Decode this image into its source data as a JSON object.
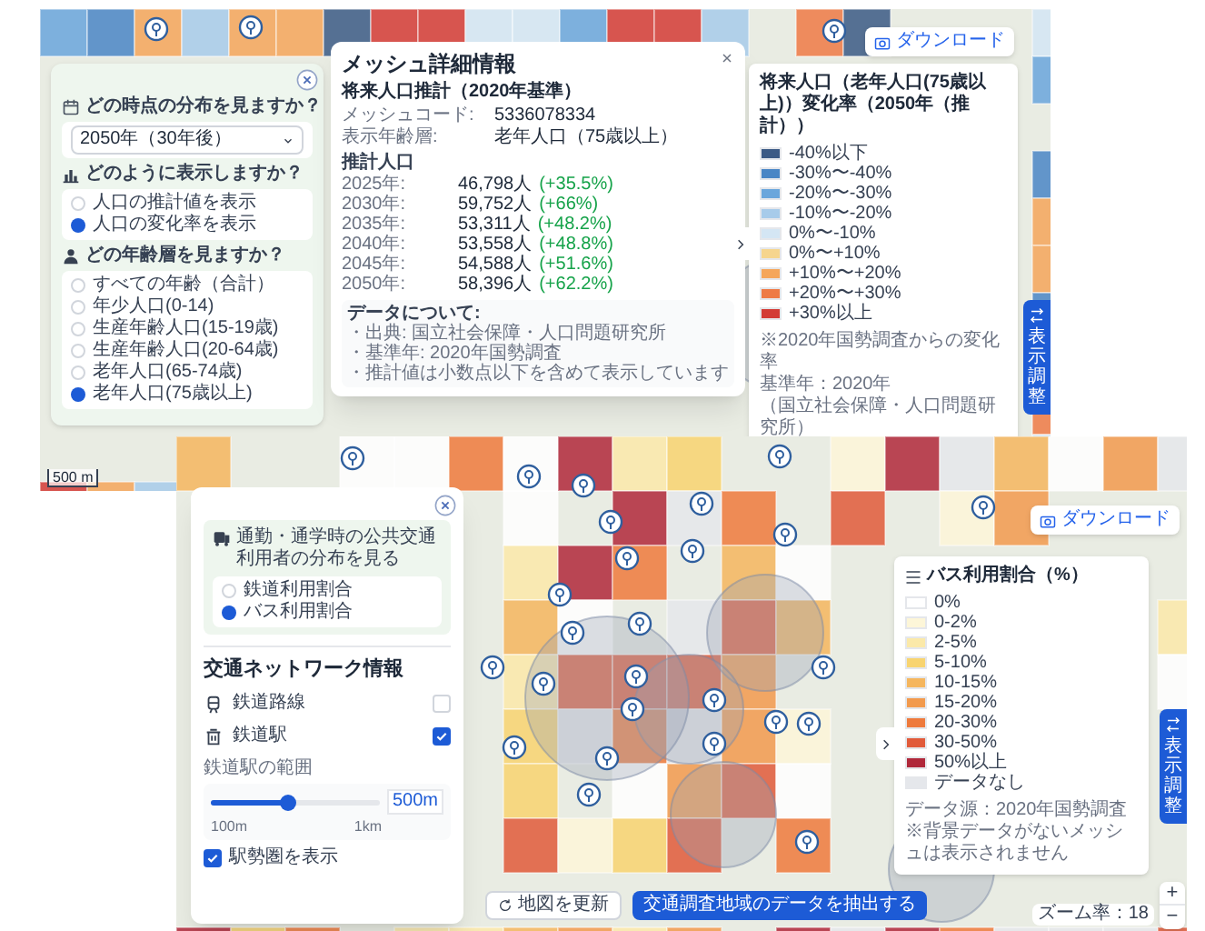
{
  "population_map": {
    "download": "ダウンロード",
    "scale": "500 m",
    "side_button": "表示調整",
    "panel": {
      "sections": [
        {
          "kind": "select",
          "title": "どの時点の分布を見ますか？",
          "value": "2050年（30年後）"
        },
        {
          "kind": "radio",
          "title": "どのように表示しますか？",
          "options": [
            {
              "label": "人口の推計値を表示",
              "selected": false
            },
            {
              "label": "人口の変化率を表示",
              "selected": true
            }
          ]
        },
        {
          "kind": "radio",
          "title": "どの年齢層を見ますか？",
          "options": [
            {
              "label": "すべての年齢（合計）",
              "selected": false
            },
            {
              "label": "年少人口(0-14)",
              "selected": false
            },
            {
              "label": "生産年齢人口(15-19歳)",
              "selected": false
            },
            {
              "label": "生産年齢人口(20-64歳)",
              "selected": false
            },
            {
              "label": "老年人口(65-74歳)",
              "selected": false
            },
            {
              "label": "老年人口(75歳以上)",
              "selected": true
            }
          ]
        }
      ]
    },
    "detail": {
      "title": "メッシュ詳細情報",
      "subtitle": "将来人口推計（2020年基準）",
      "fields": [
        {
          "label": "メッシュコード:",
          "value": "5336078334"
        },
        {
          "label": "表示年齢層:",
          "value": "老年人口（75歳以上）"
        }
      ],
      "section": "推計人口",
      "rows": [
        {
          "year": "2025年:",
          "value": "46,798人",
          "change": "(+35.5%)"
        },
        {
          "year": "2030年:",
          "value": "59,752人",
          "change": "(+66%)"
        },
        {
          "year": "2035年:",
          "value": "53,311人",
          "change": "(+48.2%)"
        },
        {
          "year": "2040年:",
          "value": "53,558人",
          "change": "(+48.8%)"
        },
        {
          "year": "2045年:",
          "value": "54,588人",
          "change": "(+51.6%)"
        },
        {
          "year": "2050年:",
          "value": "58,396人",
          "change": "(+62.2%)"
        }
      ],
      "note_title": "データについて:",
      "notes": [
        "・出典: 国立社会保障・人口問題研究所",
        "・基準年: 2020年国勢調査",
        "・推計値は小数点以下を含めて表示しています"
      ]
    },
    "legend": {
      "title": "将来人口（老年人口(75歳以上)）変化率（2050年（推計））",
      "items": [
        {
          "label": "-40%以下",
          "color": "#3b5a85"
        },
        {
          "label": "-30%〜-40%",
          "color": "#4a86c5"
        },
        {
          "label": "-20%〜-30%",
          "color": "#6aa6dc"
        },
        {
          "label": "-10%〜-20%",
          "color": "#a7cbea"
        },
        {
          "label": "0%〜-10%",
          "color": "#d4e6f4"
        },
        {
          "label": "0%〜+10%",
          "color": "#f6d58e"
        },
        {
          "label": "+10%〜+20%",
          "color": "#f5a65b"
        },
        {
          "label": "+20%〜+30%",
          "color": "#ee7a45"
        },
        {
          "label": "+30%以上",
          "color": "#d33b35"
        }
      ],
      "notes": [
        "※2020年国勢調査からの変化率",
        "基準年：2020年",
        "（国立社会保障・人口問題研究所）"
      ]
    }
  },
  "transit_map": {
    "download": "ダウンロード",
    "side_button": "表示調整",
    "zoom": "ズーム率：18",
    "zoom_in": "+",
    "zoom_out": "−",
    "panel": {
      "question": "通勤・通学時の公共交通利用者の分布を見る",
      "options": [
        {
          "label": "鉄道利用割合",
          "selected": false
        },
        {
          "label": "バス利用割合",
          "selected": true
        }
      ],
      "network_title": "交通ネットワーク情報",
      "layers": [
        {
          "kind": "line",
          "label": "鉄道路線",
          "checked": false
        },
        {
          "kind": "station",
          "label": "鉄道駅",
          "checked": true
        }
      ],
      "range_label": "鉄道駅の範囲",
      "range_value": "500m",
      "range_min": "100m",
      "range_max": "1km",
      "level": 0.45,
      "show_area": {
        "label": "駅勢圏を表示",
        "checked": true
      }
    },
    "buttons": [
      {
        "kind": "refresh",
        "label": "地図を更新"
      },
      {
        "kind": "primary",
        "label": "交通調査地域のデータを抽出する"
      }
    ],
    "legend": {
      "title": "バス利用割合（%）",
      "items": [
        {
          "label": "0%",
          "color": "#ffffff"
        },
        {
          "label": "0-2%",
          "color": "#fdf6d8"
        },
        {
          "label": "2-5%",
          "color": "#fbe9a9"
        },
        {
          "label": "5-10%",
          "color": "#f8d470"
        },
        {
          "label": "10-15%",
          "color": "#f5b65e"
        },
        {
          "label": "15-20%",
          "color": "#f29a4d"
        },
        {
          "label": "20-30%",
          "color": "#ee7a3c"
        },
        {
          "label": "30-50%",
          "color": "#e15b3a"
        },
        {
          "label": "50%以上",
          "color": "#b0283a"
        },
        {
          "label": "データなし",
          "color": "#e5e7eb"
        }
      ],
      "notes": [
        "データ源：2020年国勢調査",
        "※背景データがないメッシュは表示されません"
      ]
    }
  }
}
